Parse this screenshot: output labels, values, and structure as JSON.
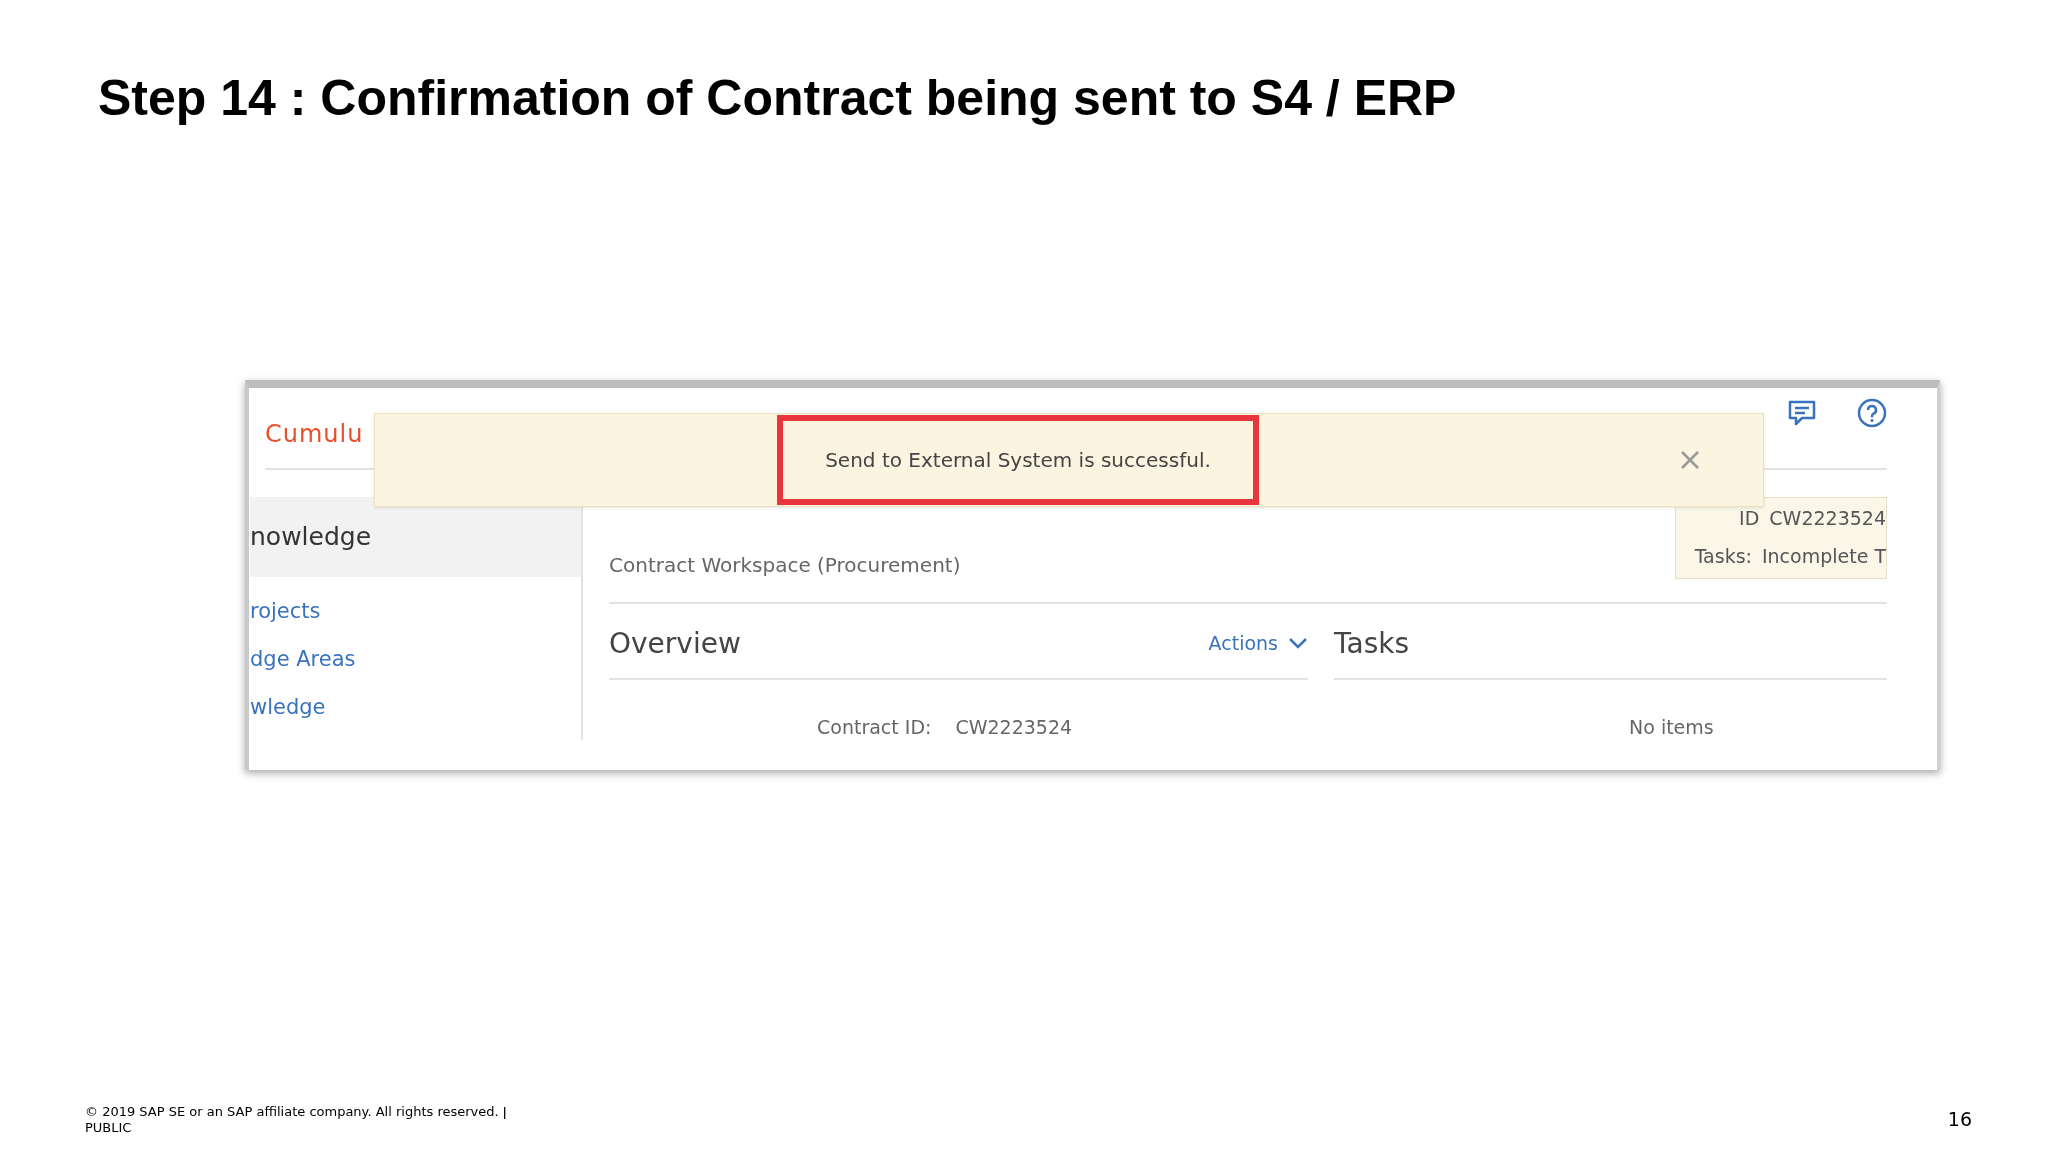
{
  "slide": {
    "title": "Step 14 : Confirmation of Contract being sent to S4 / ERP",
    "copyright": "© 2019 SAP SE or an SAP affiliate company. All rights reserved.  ǀ",
    "classification": "PUBLIC",
    "page_number": "16"
  },
  "app": {
    "logo": "Cumulu",
    "notification": {
      "message": "Send to External System is successful.",
      "highlighted": true
    },
    "sidebar": [
      {
        "label": "nowledge",
        "selected": true
      },
      {
        "label": "rojects",
        "selected": false
      },
      {
        "label": "dge Areas",
        "selected": false
      },
      {
        "label": "wledge",
        "selected": false
      }
    ],
    "subtitle": "Contract Workspace (Procurement)",
    "info": {
      "id_label": "ID",
      "id_value": "CW2223524",
      "tasks_label": "Tasks:",
      "tasks_value": "Incomplete T"
    },
    "overview": {
      "title": "Overview",
      "actions": "Actions",
      "fields": [
        {
          "label": "Contract ID:",
          "value": "CW2223524"
        }
      ]
    },
    "tasks": {
      "title": "Tasks",
      "empty": "No items"
    }
  }
}
